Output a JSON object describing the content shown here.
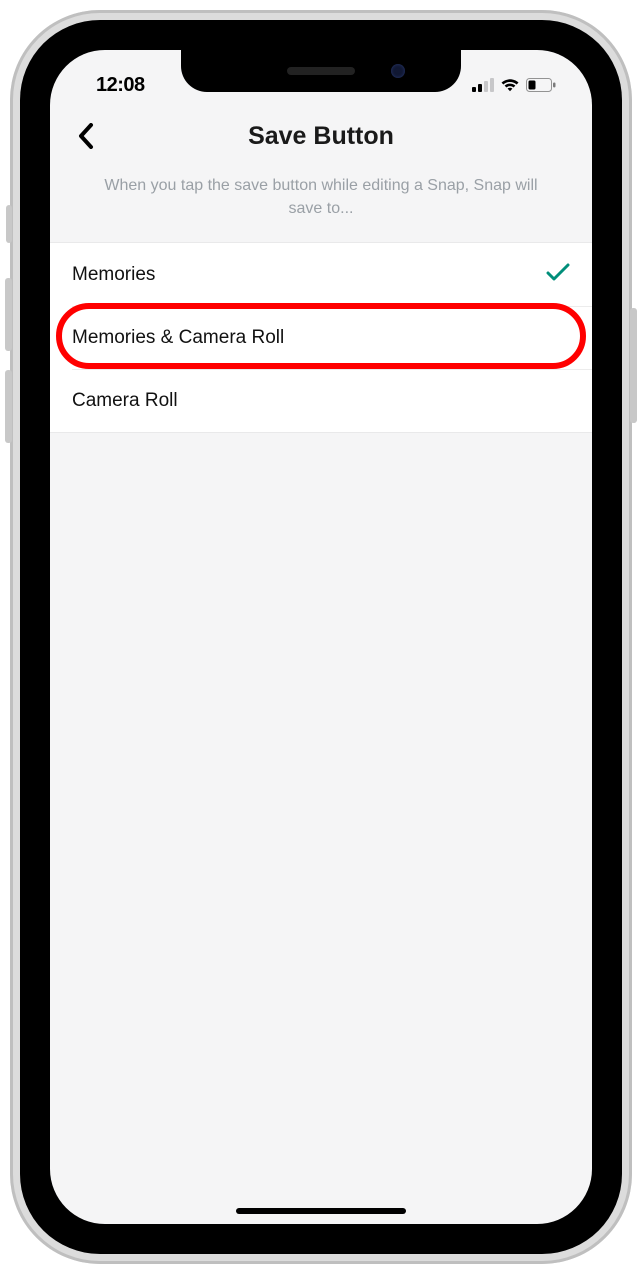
{
  "status": {
    "time": "12:08"
  },
  "header": {
    "title": "Save Button"
  },
  "description": "When you tap the save button while editing a Snap, Snap will save to...",
  "options": [
    {
      "label": "Memories",
      "selected": true
    },
    {
      "label": "Memories & Camera Roll",
      "selected": false
    },
    {
      "label": "Camera Roll",
      "selected": false
    }
  ],
  "highlight_index": 1
}
